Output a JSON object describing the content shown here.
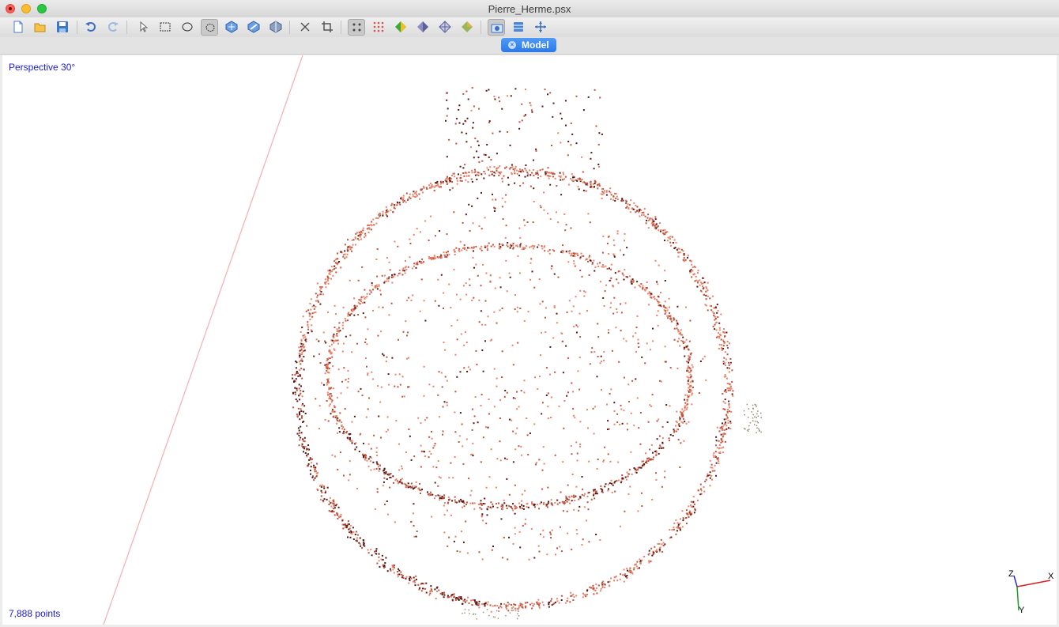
{
  "window": {
    "title": "Pierre_Herme.psx"
  },
  "toolbar": {
    "buttons": [
      "new-icon",
      "open-icon",
      "save-icon",
      "undo-icon",
      "redo-icon",
      "select-icon",
      "rect-select-icon",
      "circle-select-icon",
      "free-select-icon",
      "move-object-icon",
      "rotate-object-icon",
      "scale-object-icon",
      "delete-selection-icon",
      "crop-selection-icon",
      "point-cloud-icon",
      "dense-cloud-icon",
      "shaded-model-icon",
      "solid-model-icon",
      "wireframe-model-icon",
      "textured-model-icon",
      "show-cameras-icon",
      "show-region-icon",
      "navigation-icon"
    ]
  },
  "tab": {
    "label": "Model",
    "close_glyph": "×"
  },
  "viewport": {
    "view_mode": "Perspective 30°",
    "point_count": "7,888 points",
    "axes": {
      "x": "X",
      "y": "Y",
      "z": "Z"
    }
  },
  "colors": {
    "accent": "#2a79e8",
    "overlay_text": "#1a1ad8",
    "point_light": "#e8836a",
    "point_mid": "#c0513a",
    "point_dark": "#5a1410",
    "ground_line": "#f4b3b3"
  }
}
